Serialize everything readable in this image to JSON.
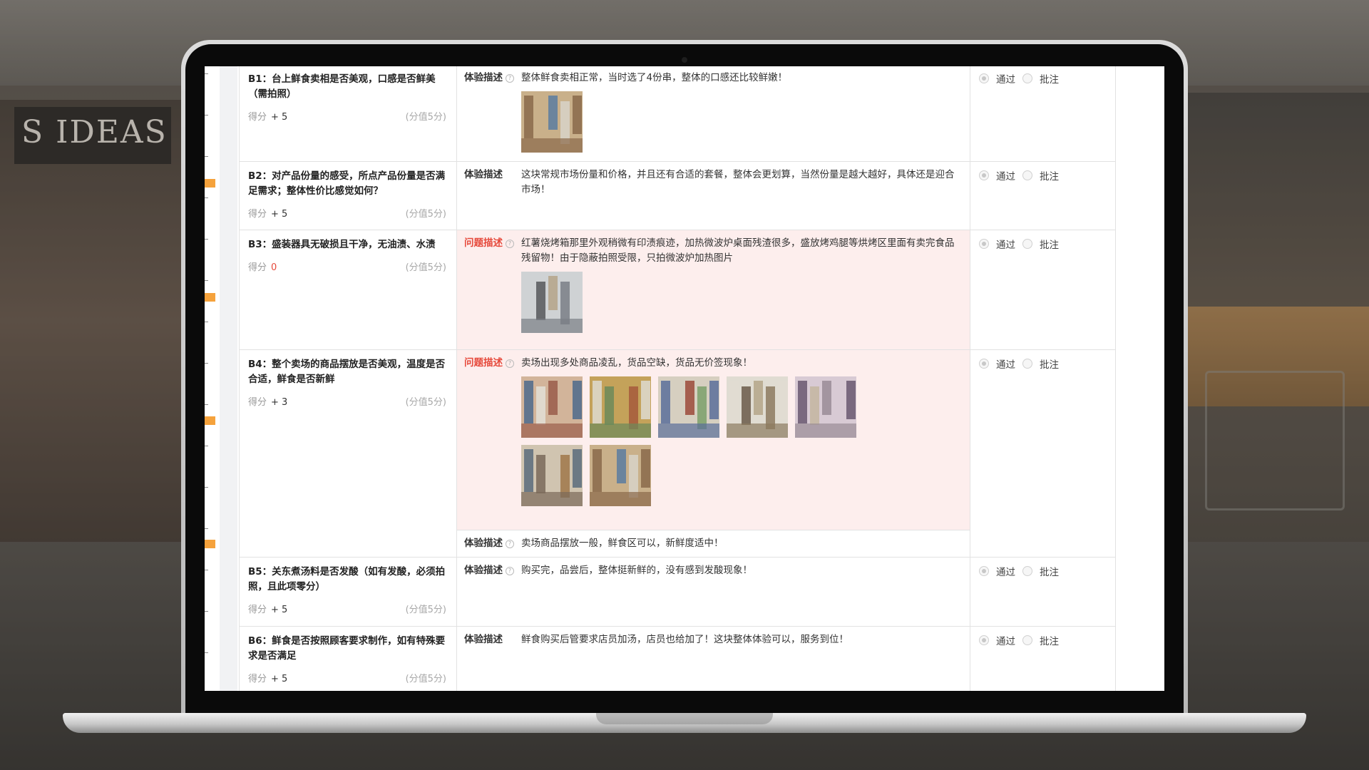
{
  "background": {
    "sign_text": "S IDEAS"
  },
  "items": [
    {
      "code": "B1",
      "title": "B1：台上鲜食卖相是否美观，口感是否鲜美（需拍照）",
      "score_label": "得分",
      "score": "+ 5",
      "max": "(分值5分)",
      "descs": [
        {
          "type": "体验描述",
          "problem": false,
          "help": true,
          "text": "整体鲜食卖相正常，当时选了4份串，整体的口感还比较鲜嫩！",
          "photos": 1
        }
      ]
    },
    {
      "code": "B2",
      "title": "B2：对产品份量的感受，所点产品份量是否满足需求；整体性价比感觉如何？",
      "score_label": "得分",
      "score": "+ 5",
      "max": "(分值5分)",
      "descs": [
        {
          "type": "体验描述",
          "problem": false,
          "help": false,
          "text": "这块常规市场份量和价格，并且还有合适的套餐，整体会更划算，当然份量是越大越好，具体还是迎合市场！",
          "photos": 0
        }
      ]
    },
    {
      "code": "B3",
      "title": "B3：盛装器具无破损且干净，无油渍、水渍",
      "score_label": "得分",
      "score": "0",
      "max": "(分值5分)",
      "descs": [
        {
          "type": "问题描述",
          "problem": true,
          "help": true,
          "text": "红薯烧烤箱那里外观稍微有印渍痕迹，加热微波炉桌面残渣很多，盛放烤鸡腿等烘烤区里面有卖完食品残留物！由于隐蔽拍照受限，只拍微波炉加热图片",
          "photos": 1
        }
      ]
    },
    {
      "code": "B4",
      "title": "B4：整个卖场的商品摆放是否美观，温度是否合适，鲜食是否新鲜",
      "score_label": "得分",
      "score": "+ 3",
      "max": "(分值5分)",
      "descs": [
        {
          "type": "问题描述",
          "problem": true,
          "help": true,
          "text": "卖场出现多处商品凌乱，货品空缺，货品无价签现象！",
          "photos": 7
        },
        {
          "type": "体验描述",
          "problem": false,
          "help": true,
          "text": "卖场商品摆放一般，鲜食区可以，新鲜度适中！",
          "photos": 0
        }
      ]
    },
    {
      "code": "B5",
      "title": "B5：关东煮汤料是否发酸（如有发酸，必须拍照，且此项零分）",
      "score_label": "得分",
      "score": "+ 5",
      "max": "(分值5分)",
      "descs": [
        {
          "type": "体验描述",
          "problem": false,
          "help": true,
          "text": "购买完，品尝后，整体挺新鲜的，没有感到发酸现象！",
          "photos": 0
        }
      ]
    },
    {
      "code": "B6",
      "title": "B6：鲜食是否按照顾客要求制作，如有特殊要求是否满足",
      "score_label": "得分",
      "score": "+ 5",
      "max": "(分值5分)",
      "descs": [
        {
          "type": "体验描述",
          "problem": false,
          "help": false,
          "text": "鲜食购买后管要求店员加汤，店员也给加了！这块整体体验可以，服务到位！",
          "photos": 0
        }
      ]
    }
  ],
  "options": {
    "pass": "通过",
    "annotate": "批注"
  },
  "colors": {
    "accent": "#f5a23c",
    "problem": "#e64a3c",
    "problem_bg": "#fdeeed"
  }
}
